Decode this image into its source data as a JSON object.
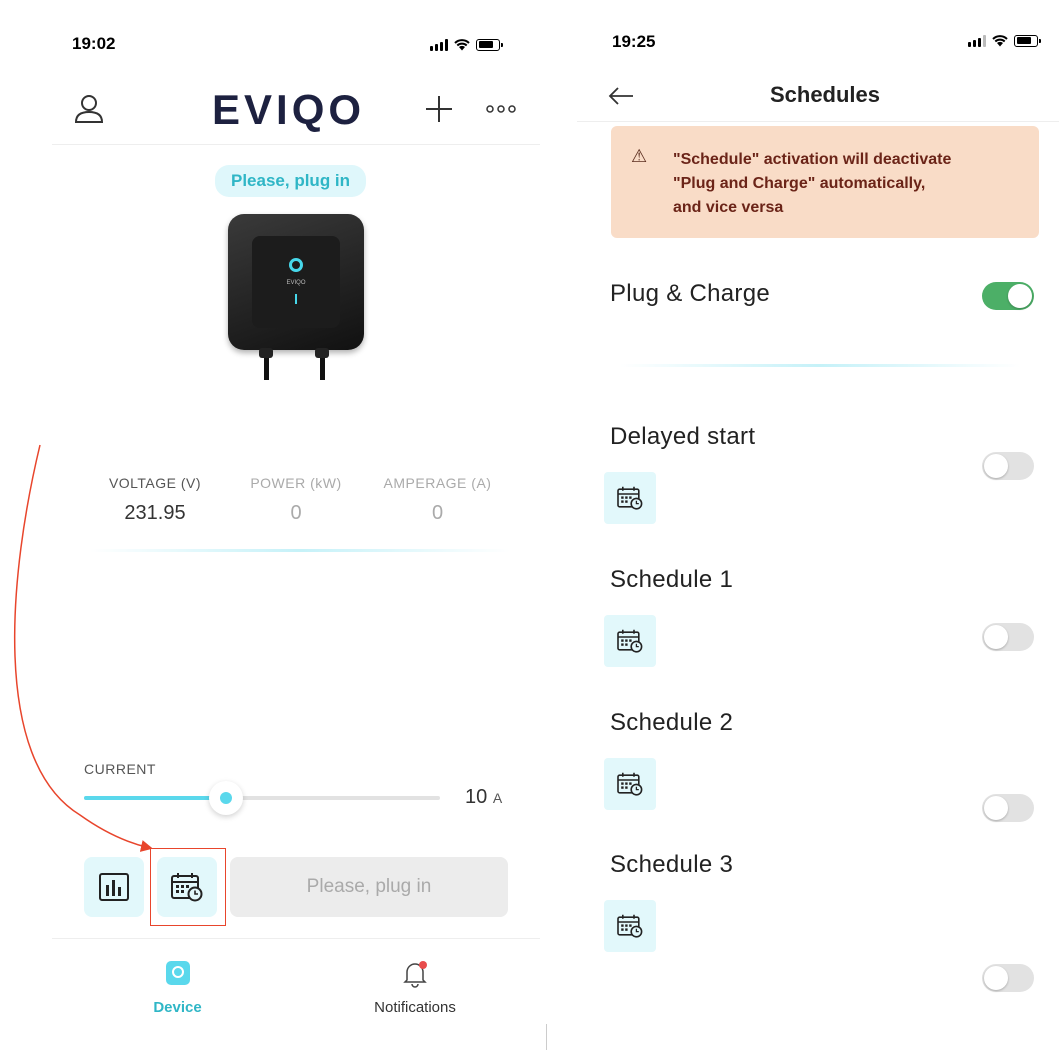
{
  "left": {
    "status_time": "19:02",
    "logo": "EVIQO",
    "header_plus": "+",
    "status_pill": "Please, plug in",
    "charger_brand": "EVIQO",
    "metrics": [
      {
        "label": "VOLTAGE (V)",
        "value": "231.95"
      },
      {
        "label": "POWER (kW)",
        "value": "0"
      },
      {
        "label": "AMPERAGE (A)",
        "value": "0"
      }
    ],
    "current_label": "CURRENT",
    "current_value": "10",
    "current_unit": "A",
    "current_slider_fraction": 0.4,
    "plug_button": "Please, plug in",
    "nav": [
      {
        "label": "Device",
        "active": true
      },
      {
        "label": "Notifications",
        "active": false
      }
    ]
  },
  "right": {
    "status_time": "19:25",
    "title": "Schedules",
    "warning": [
      "\"Schedule\" activation will deactivate",
      "\"Plug and Charge\" automatically,",
      "and vice versa"
    ],
    "warning_icon": "⚠",
    "rows": [
      {
        "label": "Plug & Charge",
        "on": true
      },
      {
        "label": "Delayed start",
        "on": false
      },
      {
        "label": "Schedule 1",
        "on": false
      },
      {
        "label": "Schedule 2",
        "on": false
      },
      {
        "label": "Schedule 3",
        "on": false
      }
    ]
  },
  "colors": {
    "accent": "#2fb6c6",
    "slider": "#5ad8ec",
    "toggle_on": "#4caf67",
    "warning_bg": "#f9dcc7",
    "warning_text": "#6b2418",
    "annotation": "#e8452c",
    "logo": "#1d2140"
  }
}
